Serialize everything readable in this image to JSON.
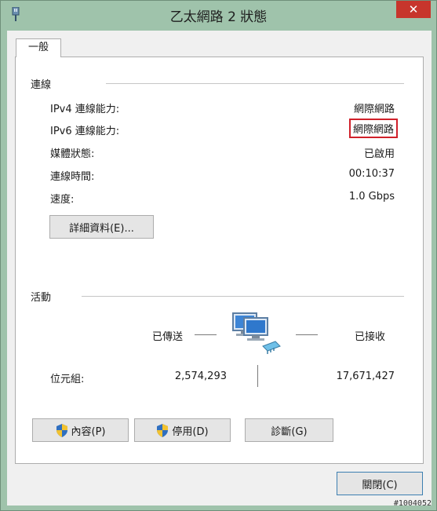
{
  "window": {
    "title": "乙太網路 2 狀態",
    "close_label": "✕"
  },
  "tab": {
    "label": "一般"
  },
  "connection": {
    "section_title": "連線",
    "rows": [
      {
        "label": "IPv4 連線能力:",
        "value": "網際網路"
      },
      {
        "label": "IPv6 連線能力:",
        "value": "網際網路"
      },
      {
        "label": "媒體狀態:",
        "value": "已啟用"
      },
      {
        "label": "連線時間:",
        "value": "00:10:37"
      },
      {
        "label": "速度:",
        "value": "1.0 Gbps"
      }
    ],
    "details_button": "詳細資料(E)..."
  },
  "activity": {
    "section_title": "活動",
    "sent_label": "已傳送",
    "received_label": "已接收",
    "bytes_label": "位元組:",
    "bytes_sent": "2,574,293",
    "bytes_received": "17,671,427"
  },
  "actions": {
    "properties": "內容(P)",
    "disable": "停用(D)",
    "diagnose": "診斷(G)",
    "close": "關閉(C)"
  },
  "watermark": "#1004052",
  "colors": {
    "frame": "#9fc3ab",
    "highlight_border": "#d0202a",
    "close_button": "#c7352c"
  }
}
